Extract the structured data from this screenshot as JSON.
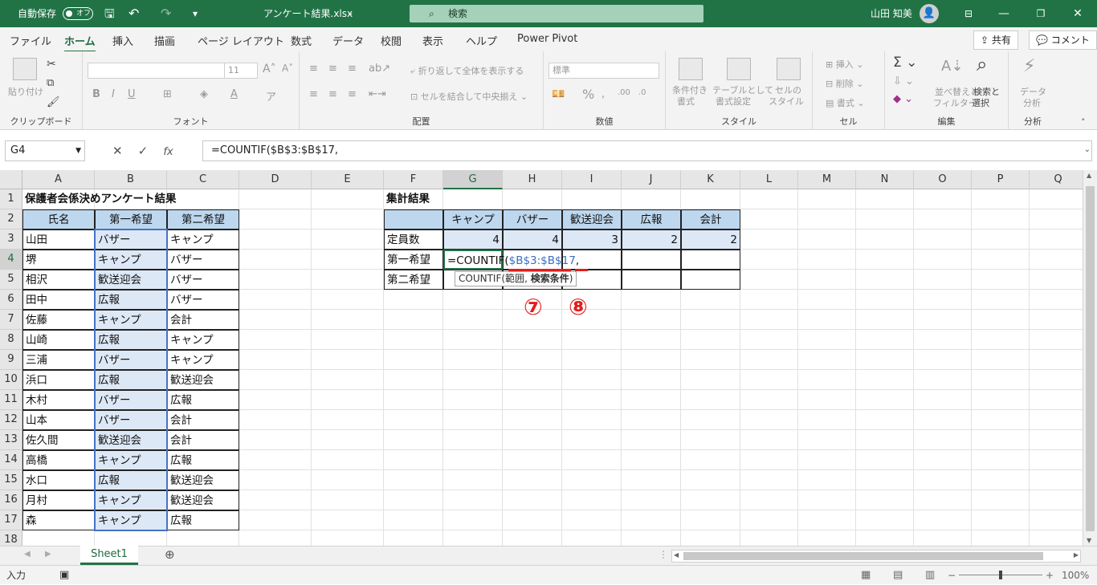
{
  "titlebar": {
    "autosave_label": "自動保存",
    "autosave_state": "オフ",
    "filename": "アンケート結果.xlsx",
    "search_placeholder": "検索",
    "user_name": "山田 知美"
  },
  "tabs": [
    "ファイル",
    "ホーム",
    "挿入",
    "描画",
    "ページ レイアウト",
    "数式",
    "データ",
    "校閲",
    "表示",
    "ヘルプ",
    "Power Pivot"
  ],
  "active_tab": "ホーム",
  "share_label": "共有",
  "comment_label": "コメント",
  "ribbon": {
    "clipboard": {
      "label": "クリップボード",
      "paste": "貼り付け"
    },
    "font": {
      "label": "フォント",
      "size": "11"
    },
    "alignment": {
      "label": "配置",
      "wrap": "折り返して全体を表示する",
      "merge": "セルを結合して中央揃え"
    },
    "number": {
      "label": "数値",
      "format": "標準"
    },
    "styles": {
      "label": "スタイル",
      "cond1": "条件付き",
      "cond2": "書式",
      "table1": "テーブルとして",
      "table2": "書式設定",
      "cell1": "セルの",
      "cell2": "スタイル"
    },
    "cells": {
      "label": "セル",
      "insert": "挿入",
      "delete": "削除",
      "format": "書式"
    },
    "edit": {
      "label": "編集",
      "sort1": "並べ替えと",
      "sort2": "フィルター",
      "find1": "検索と",
      "find2": "選択"
    },
    "analysis": {
      "label": "分析",
      "a1": "データ",
      "a2": "分析"
    }
  },
  "formula_bar": {
    "name_box": "G4",
    "formula": "=COUNTIF($B$3:$B$17,"
  },
  "columns": [
    "A",
    "B",
    "C",
    "D",
    "E",
    "F",
    "G",
    "H",
    "I",
    "J",
    "K",
    "L",
    "M",
    "N",
    "O",
    "P",
    "Q"
  ],
  "rows": [
    "1",
    "2",
    "3",
    "4",
    "5",
    "6",
    "7",
    "8",
    "9",
    "10",
    "11",
    "12",
    "13",
    "14",
    "15",
    "16",
    "17",
    "18"
  ],
  "sheet": {
    "title": "保護者会係決めアンケート結果",
    "headers": [
      "氏名",
      "第一希望",
      "第二希望"
    ],
    "records": [
      [
        "山田",
        "バザー",
        "キャンプ"
      ],
      [
        "堺",
        "キャンプ",
        "バザー"
      ],
      [
        "相沢",
        "歓送迎会",
        "バザー"
      ],
      [
        "田中",
        "広報",
        "バザー"
      ],
      [
        "佐藤",
        "キャンプ",
        "会計"
      ],
      [
        "山崎",
        "広報",
        "キャンプ"
      ],
      [
        "三浦",
        "バザー",
        "キャンプ"
      ],
      [
        "浜口",
        "広報",
        "歓送迎会"
      ],
      [
        "木村",
        "バザー",
        "広報"
      ],
      [
        "山本",
        "バザー",
        "会計"
      ],
      [
        "佐久間",
        "歓送迎会",
        "会計"
      ],
      [
        "高橋",
        "キャンプ",
        "広報"
      ],
      [
        "水口",
        "広報",
        "歓送迎会"
      ],
      [
        "月村",
        "キャンプ",
        "歓送迎会"
      ],
      [
        "森",
        "キャンプ",
        "広報"
      ]
    ],
    "summary_title": "集計結果",
    "summary_headers": [
      "キャンプ",
      "バザー",
      "歓送迎会",
      "広報",
      "会計"
    ],
    "summary_rows": [
      {
        "label": "定員数",
        "values": [
          "4",
          "4",
          "3",
          "2",
          "2"
        ]
      },
      {
        "label": "第一希望",
        "values": [
          "",
          "",
          "",
          "",
          ""
        ]
      },
      {
        "label": "第二希望",
        "values": [
          "",
          "",
          "",
          "",
          ""
        ]
      }
    ],
    "edit_cell": {
      "prefix": "=COUNTIF(",
      "ref": "$B$3:$B$17",
      "suffix": ","
    },
    "tooltip": {
      "func": "COUNTIF(",
      "arg1": "範囲",
      "sep": ", ",
      "arg2": "検索条件",
      "close": ")"
    }
  },
  "markers": [
    "⑦",
    "⑧"
  ],
  "sheet_tab": "Sheet1",
  "status": {
    "mode": "入力",
    "zoom": "100%"
  }
}
